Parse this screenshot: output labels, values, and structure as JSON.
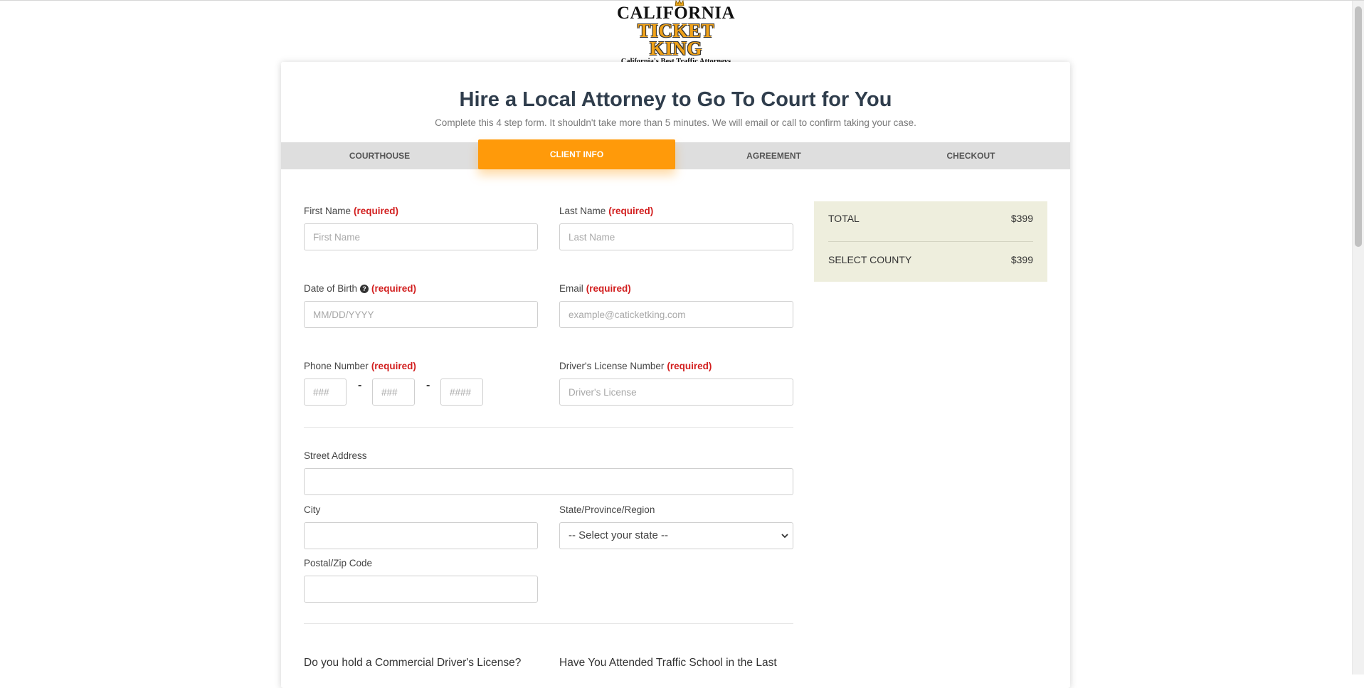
{
  "logo": {
    "line1": "CALIFORNIA",
    "line2": "TICKET KING",
    "tagline": "California's Best Traffic Attorneys"
  },
  "header": {
    "title": "Hire a Local Attorney to Go To Court for You",
    "subtitle": "Complete this 4 step form. It shouldn't take more than 5 minutes. We will email or call to confirm taking your case."
  },
  "tabs": [
    {
      "label": "COURTHOUSE"
    },
    {
      "label": "CLIENT INFO"
    },
    {
      "label": "AGREEMENT"
    },
    {
      "label": "CHECKOUT"
    }
  ],
  "active_tab": "CLIENT INFO",
  "form": {
    "required_text": "(required)",
    "first_name": {
      "label": "First Name",
      "placeholder": "First Name",
      "value": ""
    },
    "last_name": {
      "label": "Last Name",
      "placeholder": "Last Name",
      "value": ""
    },
    "dob": {
      "label": "Date of Birth",
      "placeholder": "MM/DD/YYYY",
      "help_icon": "question-circle-icon",
      "help_glyph": "?"
    },
    "email": {
      "label": "Email",
      "placeholder": "example@caticketking.com"
    },
    "phone": {
      "label": "Phone Number",
      "p1": "###",
      "p2": "###",
      "p3": "####",
      "separator": "-"
    },
    "license": {
      "label": "Driver's License Number",
      "placeholder": "Driver's License"
    },
    "street": {
      "label": "Street Address"
    },
    "city": {
      "label": "City"
    },
    "state": {
      "label": "State/Province/Region",
      "selected": "-- Select your state --"
    },
    "zip": {
      "label": "Postal/Zip Code"
    },
    "q_commercial": "Do you hold a Commercial Driver's License?",
    "q_traffic_school": "Have You Attended Traffic School in the Last"
  },
  "summary": {
    "rows": [
      {
        "label": "TOTAL",
        "value": "$399"
      },
      {
        "label": "SELECT COUNTY",
        "value": "$399"
      }
    ]
  },
  "colors": {
    "accent": "#ff9a0a",
    "required": "#d21e1e",
    "summary_bg": "#eeeedd",
    "title": "#2f3d4c"
  }
}
